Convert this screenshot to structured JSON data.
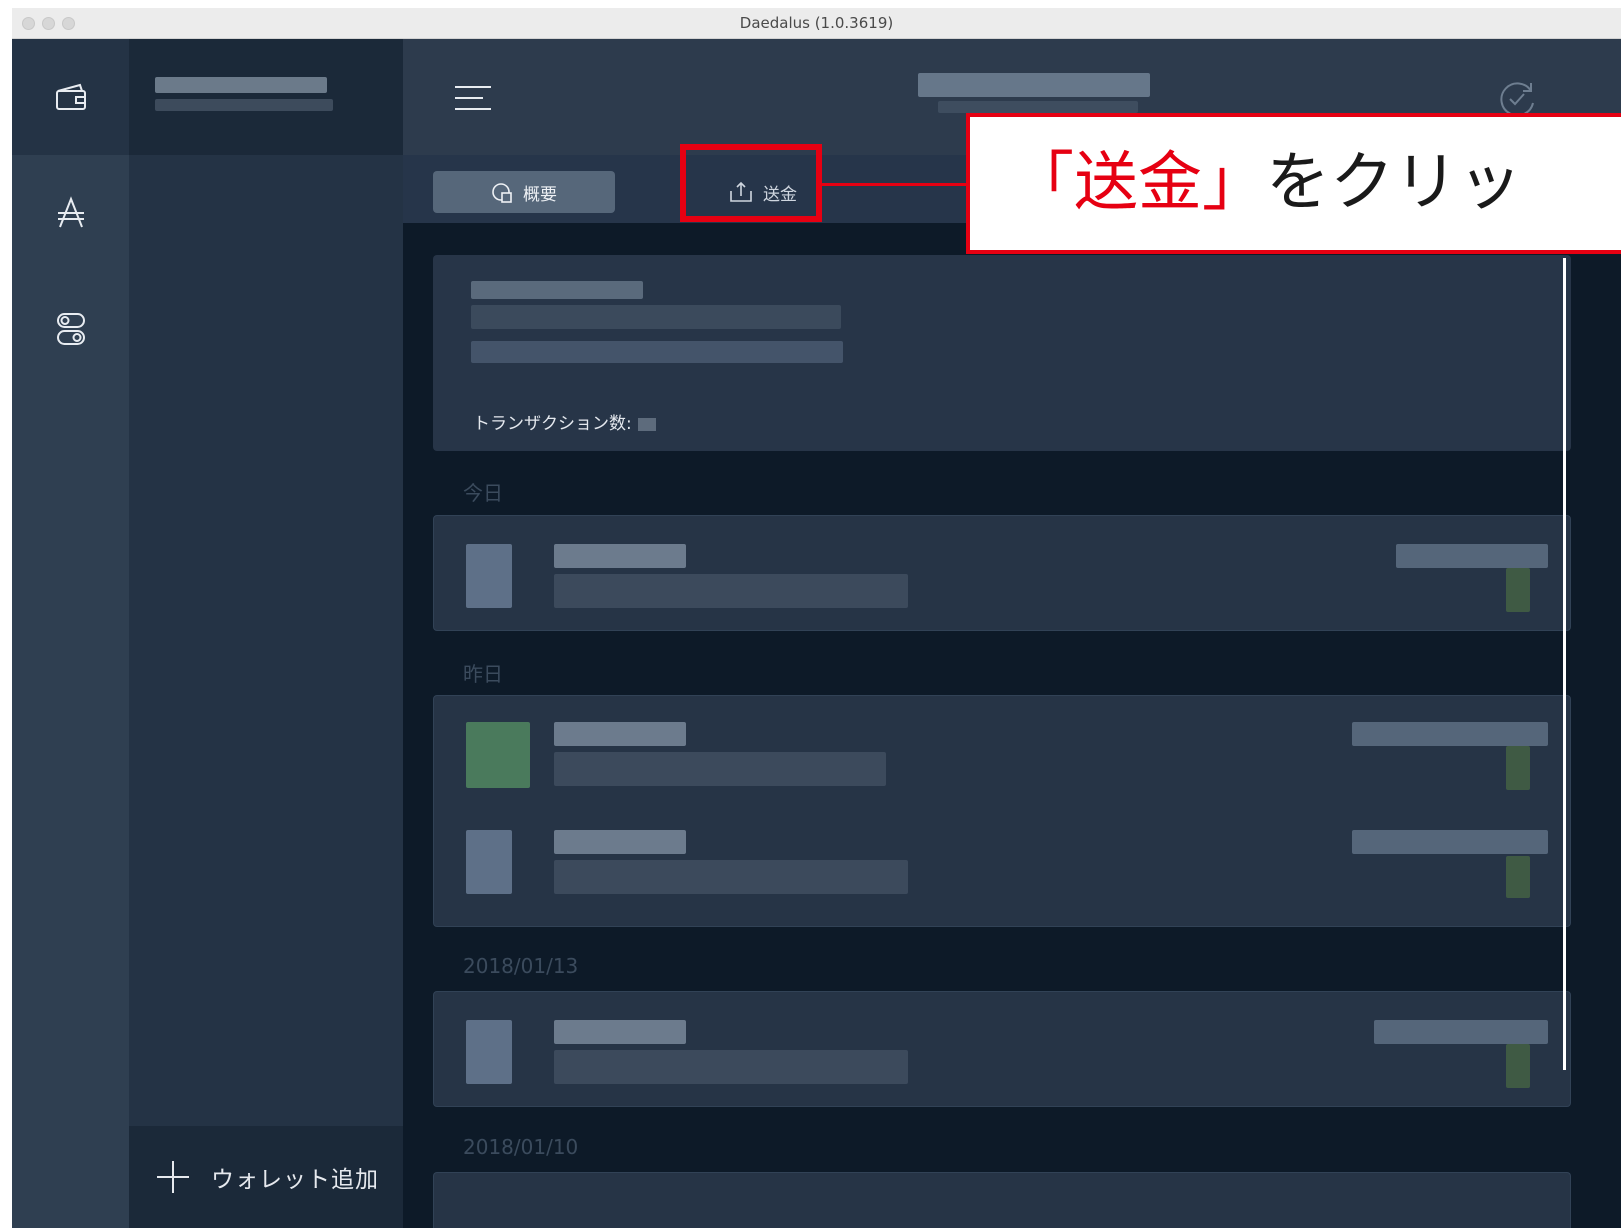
{
  "window": {
    "title": "Daedalus (1.0.3619)"
  },
  "rail": {
    "items": [
      {
        "icon": "wallet-icon"
      },
      {
        "icon": "ada-icon"
      },
      {
        "icon": "settings-toggle-icon"
      }
    ]
  },
  "sidebar": {
    "add_wallet_label": "ウォレット追加"
  },
  "tabs": [
    {
      "label": "概要",
      "icon": "summary-icon"
    },
    {
      "label": "送金",
      "icon": "send-icon"
    }
  ],
  "summary": {
    "tx_count_label": "トランザクション数:"
  },
  "dates": {
    "today": "今日",
    "yesterday": "昨日",
    "d1": "2018/01/13",
    "d2": "2018/01/10"
  },
  "callout": {
    "quoted": "「送金」",
    "rest": "をクリッ"
  },
  "colors": {
    "accent_red": "#e60012",
    "background": "#0d1a28",
    "card": "#273548"
  }
}
